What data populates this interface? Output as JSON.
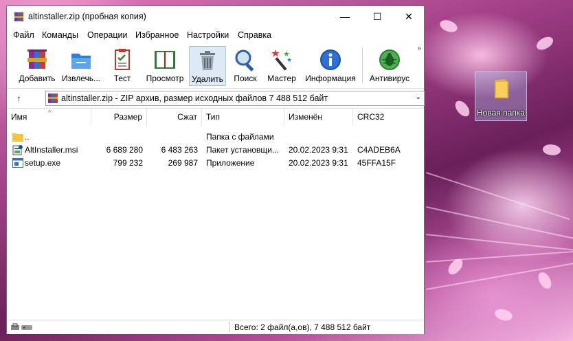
{
  "window": {
    "title": "altinstaller.zip (пробная копия)",
    "minimize": "—",
    "maximize": "☐",
    "close": "✕"
  },
  "menu": [
    "Файл",
    "Команды",
    "Операции",
    "Избранное",
    "Настройки",
    "Справка"
  ],
  "toolbar": {
    "buttons": [
      {
        "label": "Добавить",
        "icon": "add-archive-icon"
      },
      {
        "label": "Извлечь...",
        "icon": "extract-icon"
      },
      {
        "label": "Тест",
        "icon": "test-icon"
      },
      {
        "label": "Просмотр",
        "icon": "view-book-icon"
      },
      {
        "label": "Удалить",
        "icon": "trash-icon"
      },
      {
        "label": "Поиск",
        "icon": "magnifier-icon"
      },
      {
        "label": "Мастер",
        "icon": "wizard-wand-icon"
      },
      {
        "label": "Информация",
        "icon": "info-icon"
      },
      {
        "label": "Антивирус",
        "icon": "antivirus-bug-icon"
      }
    ],
    "overflow": "»"
  },
  "address": {
    "up": "↑",
    "text": "altinstaller.zip - ZIP архив, размер исходных файлов 7 488 512 байт",
    "dropdown": "⌄"
  },
  "columns": [
    "Имя",
    "Размер",
    "Сжат",
    "Тип",
    "Изменён",
    "CRC32"
  ],
  "files": [
    {
      "name": "..",
      "size": "",
      "packed": "",
      "type": "Папка с файлами",
      "modified": "",
      "crc": "",
      "icon": "folder-icon"
    },
    {
      "name": "AltInstaller.msi",
      "size": "6 689 280",
      "packed": "6 483 263",
      "type": "Пакет установщи...",
      "modified": "20.02.2023 9:31",
      "crc": "C4ADEB6A",
      "icon": "msi-package-icon"
    },
    {
      "name": "setup.exe",
      "size": "799 232",
      "packed": "269 987",
      "type": "Приложение",
      "modified": "20.02.2023 9:31",
      "crc": "45FFA15F",
      "icon": "exe-app-icon"
    }
  ],
  "status": {
    "text": "Всего: 2 файл(а,ов), 7 488 512 байт"
  },
  "desktop": {
    "folder_label": "Новая папка"
  },
  "colors": {
    "accent": "#0078d7",
    "toolbar_active": "#dde9f5",
    "folder": "#f5c542"
  }
}
